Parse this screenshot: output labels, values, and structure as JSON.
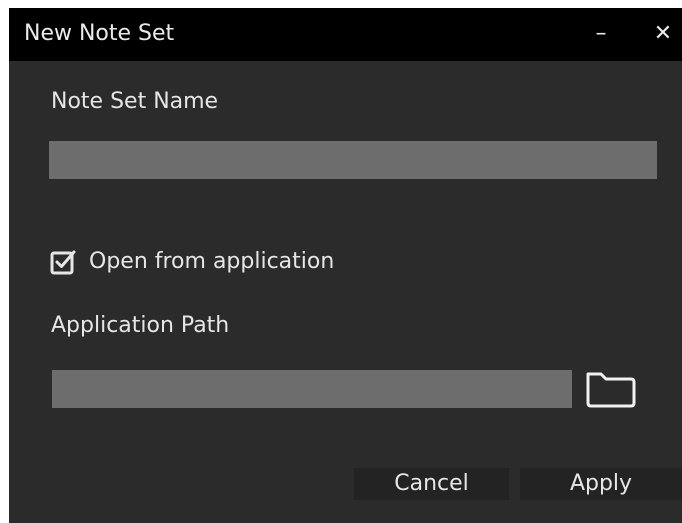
{
  "window": {
    "title": "New Note Set",
    "minimize_glyph": "–",
    "close_glyph": "✕"
  },
  "form": {
    "name_label": "Note Set Name",
    "name_value": "",
    "open_from_app_label": "Open from application",
    "open_from_app_checked": true,
    "path_label": "Application Path",
    "path_value": "",
    "browse_icon": "folder-icon"
  },
  "buttons": {
    "cancel": "Cancel",
    "apply": "Apply"
  },
  "colors": {
    "titlebar": "#000000",
    "background": "#2b2b2b",
    "input": "#6d6d6d",
    "text": "#e6e6e6"
  }
}
